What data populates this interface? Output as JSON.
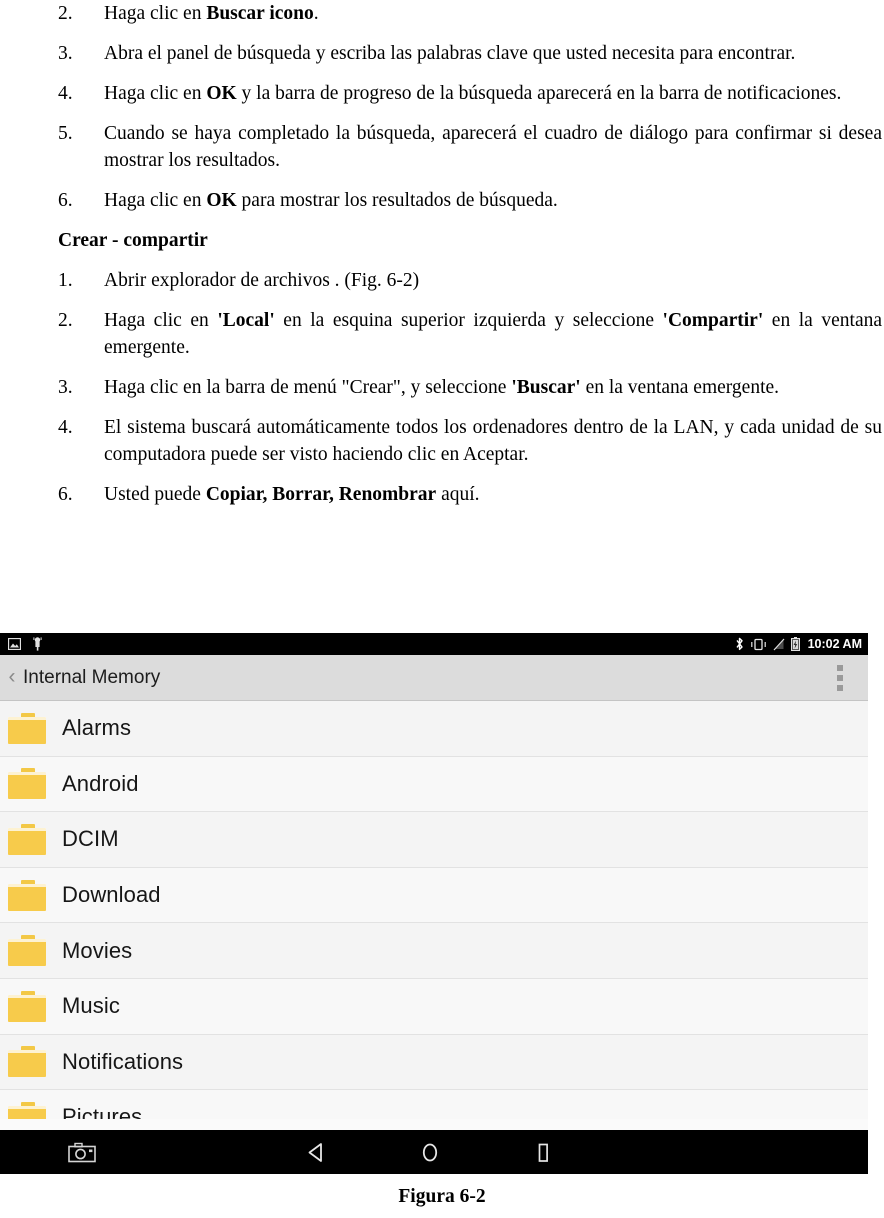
{
  "document": {
    "items": [
      {
        "num": "2.",
        "parts": [
          {
            "t": "Haga clic en ",
            "b": false
          },
          {
            "t": "Buscar icono",
            "b": true
          },
          {
            "t": ".",
            "b": false
          }
        ]
      },
      {
        "num": "3.",
        "parts": [
          {
            "t": "Abra el panel de búsqueda y escriba las palabras clave que usted necesita para encontrar.",
            "b": false
          }
        ]
      },
      {
        "num": "4.",
        "parts": [
          {
            "t": "Haga clic en ",
            "b": false
          },
          {
            "t": "OK",
            "b": true
          },
          {
            "t": " y la barra de progreso de la búsqueda aparecerá en la barra de notificaciones.",
            "b": false
          }
        ]
      },
      {
        "num": "5.",
        "parts": [
          {
            "t": "Cuando se haya completado la búsqueda, aparecerá el cuadro de diálogo para confirmar si desea mostrar los resultados.",
            "b": false
          }
        ]
      },
      {
        "num": "6.",
        "parts": [
          {
            "t": "Haga clic en ",
            "b": false
          },
          {
            "t": "OK",
            "b": true
          },
          {
            "t": " para mostrar los resultados de búsqueda.",
            "b": false
          }
        ]
      }
    ],
    "heading": "Crear - compartir",
    "items2": [
      {
        "num": "1.",
        "parts": [
          {
            "t": "Abrir explorador de archivos . (Fig. 6-2)",
            "b": false
          }
        ]
      },
      {
        "num": "2.",
        "parts": [
          {
            "t": "Haga clic en ",
            "b": false
          },
          {
            "t": "'Local'",
            "b": true
          },
          {
            "t": " en la esquina superior izquierda y seleccione ",
            "b": false
          },
          {
            "t": "'Compartir'",
            "b": true
          },
          {
            "t": " en la ventana emergente.",
            "b": false
          }
        ]
      },
      {
        "num": "3.",
        "parts": [
          {
            "t": "Haga clic en la barra de menú \"Crear\", y seleccione ",
            "b": false
          },
          {
            "t": "'Buscar'",
            "b": true
          },
          {
            "t": " en la ventana emergente.",
            "b": false
          }
        ]
      },
      {
        "num": "4.",
        "parts": [
          {
            "t": "El sistema buscará automáticamente todos los ordenadores dentro de la LAN, y cada unidad de su computadora puede ser visto haciendo clic en Aceptar.",
            "b": false
          }
        ]
      },
      {
        "num": "6.",
        "parts": [
          {
            "t": "Usted puede ",
            "b": false
          },
          {
            "t": "Copiar, Borrar, Renombrar",
            "b": true
          },
          {
            "t": " aquí.",
            "b": false
          }
        ]
      }
    ]
  },
  "screenshot": {
    "statusbar": {
      "left_icons": [
        "screenshot-icon",
        "usb-debug-icon"
      ],
      "right_icons": [
        "bluetooth-icon",
        "vibrate-icon",
        "signal-off-icon",
        "battery-charging-icon"
      ],
      "time": "10:02 AM",
      "background_color": "#000000",
      "text_color": "#ffffff"
    },
    "toolbar": {
      "back_glyph": "‹",
      "title": "Internal Memory",
      "overflow_label": "overflow-menu",
      "background_color": "#dcdcdc"
    },
    "files": [
      {
        "name": "Alarms",
        "icon": "folder-icon"
      },
      {
        "name": "Android",
        "icon": "folder-icon"
      },
      {
        "name": "DCIM",
        "icon": "folder-icon"
      },
      {
        "name": "Download",
        "icon": "folder-icon"
      },
      {
        "name": "Movies",
        "icon": "folder-icon"
      },
      {
        "name": "Music",
        "icon": "folder-icon"
      },
      {
        "name": "Notifications",
        "icon": "folder-icon"
      },
      {
        "name": "Pictures",
        "icon": "folder-icon"
      }
    ],
    "navbar": {
      "buttons": [
        "screenshot-button",
        "back-button",
        "home-button",
        "recents-button"
      ],
      "background_color": "#000000"
    },
    "folder_color": "#f7cb4b"
  },
  "caption": "Figura 6-2"
}
